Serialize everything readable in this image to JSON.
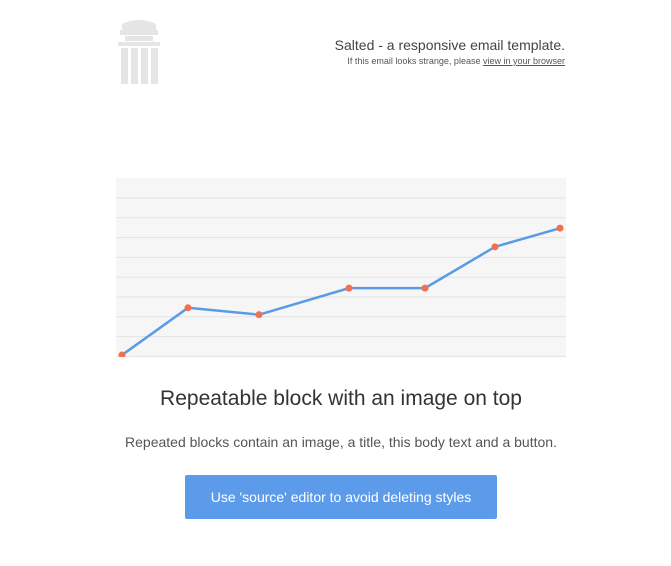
{
  "header": {
    "title": "Salted - a responsive email template.",
    "subtext": "If this email looks strange, please ",
    "browser_link": "view in your browser"
  },
  "logo": {
    "icon": "column-pillar-icon",
    "color": "#e5e5e5"
  },
  "content": {
    "title": "Repeatable block with an image on top",
    "body": "Repeated blocks contain an image, a title, this body text and a button.",
    "button_label": "Use 'source' editor to avoid deleting styles"
  },
  "colors": {
    "button": "#5c9bea",
    "line": "#5b9be6",
    "point": "#f07050",
    "chart_background": "#f6f6f6",
    "grid": "#e3e3e3"
  },
  "chart_data": {
    "type": "line",
    "title": "",
    "xlabel": "",
    "ylabel": "",
    "x": [
      1,
      2,
      3,
      4,
      5,
      6,
      7
    ],
    "series": [
      {
        "values": [
          0,
          4.8,
          4.1,
          6.8,
          6.8,
          11.0,
          12.9
        ]
      }
    ],
    "ylim": [
      0,
      18
    ],
    "grid": true,
    "grid_lines": 9,
    "legend": "none",
    "axes_visible": false
  }
}
